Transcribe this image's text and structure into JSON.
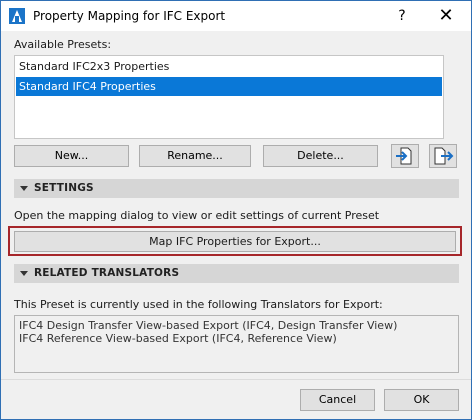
{
  "window": {
    "title": "Property Mapping for IFC Export",
    "help_label": "?",
    "close_label": "✕"
  },
  "presets": {
    "label": "Available Presets:",
    "items": [
      {
        "label": "Standard IFC2x3 Properties",
        "selected": false
      },
      {
        "label": "Standard IFC4 Properties",
        "selected": true
      }
    ],
    "buttons": {
      "new": "New...",
      "rename": "Rename...",
      "delete": "Delete..."
    },
    "icons": [
      "import-icon",
      "export-icon"
    ]
  },
  "settings": {
    "header": "SETTINGS",
    "description": "Open the mapping dialog to view or edit settings of current Preset",
    "map_button": "Map IFC Properties for Export..."
  },
  "related": {
    "header": "RELATED TRANSLATORS",
    "description": "This Preset is currently used in the following Translators for Export:",
    "translators": [
      "IFC4 Design Transfer View-based Export (IFC4, Design Transfer View)",
      "IFC4 Reference View-based Export (IFC4, Reference View)"
    ]
  },
  "footer": {
    "cancel": "Cancel",
    "ok": "OK"
  },
  "colors": {
    "selection": "#0a78d7",
    "highlight_frame": "#a6262a",
    "section_header": "#d6d6d6"
  }
}
